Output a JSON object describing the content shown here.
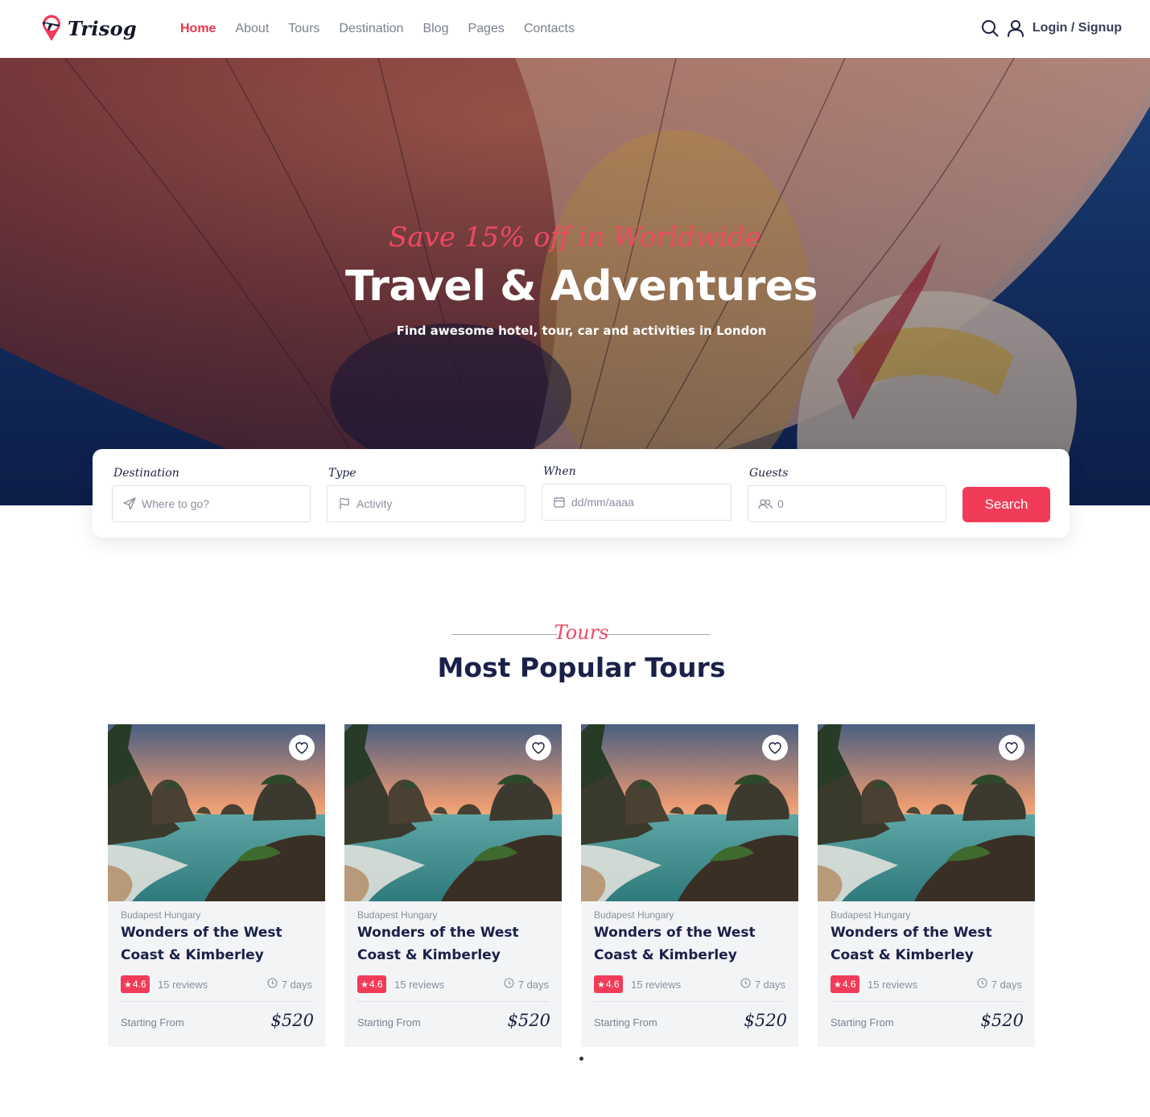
{
  "brand": {
    "name": "Trisog",
    "accent": "#f03c58",
    "dark": "#1a2149"
  },
  "nav": {
    "items": [
      {
        "label": "Home",
        "active": true
      },
      {
        "label": "About",
        "active": false
      },
      {
        "label": "Tours",
        "active": false
      },
      {
        "label": "Destination",
        "active": false
      },
      {
        "label": "Blog",
        "active": false
      },
      {
        "label": "Pages",
        "active": false
      },
      {
        "label": "Contacts",
        "active": false
      }
    ],
    "search_icon": "search-icon",
    "user_icon": "user-icon",
    "login_label": "Login / Signup"
  },
  "hero": {
    "tagline": "Save 15% off in Worldwide",
    "title": "Travel & Adventures",
    "subtitle": "Find awesome hotel, tour, car and activities in London"
  },
  "search": {
    "destination": {
      "label": "Destination",
      "placeholder": "Where to go?",
      "icon": "send-icon"
    },
    "type": {
      "label": "Type",
      "placeholder": "Activity",
      "icon": "flag-icon"
    },
    "when": {
      "label": "When",
      "placeholder": "dd/mm/aaaa",
      "icon": "calendar-icon"
    },
    "guests": {
      "label": "Guests",
      "value": "0",
      "icon": "users-icon"
    },
    "button_label": "Search"
  },
  "tours_section": {
    "kicker": "Tours",
    "title": "Most Popular Tours"
  },
  "tours": [
    {
      "location": "Budapest Hungary",
      "title": "Wonders of the West Coast & Kimberley",
      "rating": "4.6",
      "reviews": "15 reviews",
      "duration": "7 days",
      "starting_label": "Starting From",
      "price": "$520"
    },
    {
      "location": "Budapest Hungary",
      "title": "Wonders of the West Coast & Kimberley",
      "rating": "4.6",
      "reviews": "15 reviews",
      "duration": "7 days",
      "starting_label": "Starting From",
      "price": "$520"
    },
    {
      "location": "Budapest Hungary",
      "title": "Wonders of the West Coast & Kimberley",
      "rating": "4.6",
      "reviews": "15 reviews",
      "duration": "7 days",
      "starting_label": "Starting From",
      "price": "$520"
    },
    {
      "location": "Budapest Hungary",
      "title": "Wonders of the West Coast & Kimberley",
      "rating": "4.6",
      "reviews": "15 reviews",
      "duration": "7 days",
      "starting_label": "Starting From",
      "price": "$520"
    }
  ]
}
